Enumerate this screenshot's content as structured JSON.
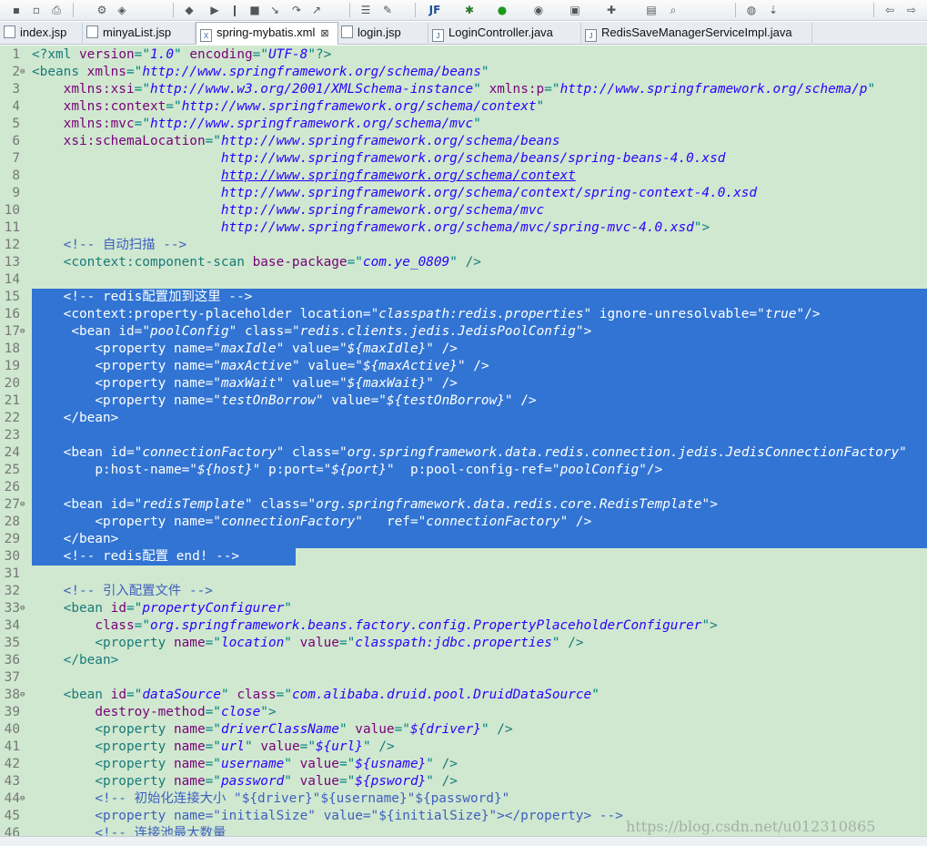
{
  "toolbar": {
    "icons": [
      "save-icon",
      "save-all-icon",
      "print-icon",
      "open-type-icon",
      "open-resource-icon",
      "toggle-breakpoint-icon",
      "resume-icon",
      "suspend-icon",
      "terminate-icon",
      "step-into-icon",
      "step-over-icon",
      "step-return-icon",
      "outline-icon",
      "toggle-comment-icon",
      "jf-icon",
      "debug-icon",
      "run-icon",
      "external-tools-icon",
      "new-server-icon",
      "new-wizard-icon",
      "open-folder-icon",
      "search-icon",
      "globe-icon",
      "next-annotation-icon",
      "back-icon",
      "forward-icon"
    ],
    "jf_label": "JF"
  },
  "tabs": [
    {
      "label": "index.jsp",
      "icon": "jsp-file-icon",
      "active": false
    },
    {
      "label": "minyaList.jsp",
      "icon": "jsp-file-icon",
      "active": false
    },
    {
      "label": "spring-mybatis.xml",
      "icon": "xml-file-icon",
      "active": true,
      "close": "⊠"
    },
    {
      "label": "login.jsp",
      "icon": "jsp-file-icon",
      "active": false
    },
    {
      "label": "LoginController.java",
      "icon": "java-file-icon",
      "active": false
    },
    {
      "label": "RedisSaveManagerServiceImpl.java",
      "icon": "java-file-icon",
      "active": false
    }
  ],
  "editor": {
    "background": "#cfe8cf",
    "selection_color": "#3174d3",
    "selected_lines": [
      15,
      30
    ],
    "lines": [
      {
        "n": "1",
        "m": "",
        "code": "<?xml version=\"1.0\" encoding=\"UTF-8\"?>"
      },
      {
        "n": "2",
        "m": "⊖",
        "code": "<beans xmlns=\"http://www.springframework.org/schema/beans\""
      },
      {
        "n": "3",
        "m": "",
        "code": "    xmlns:xsi=\"http://www.w3.org/2001/XMLSchema-instance\" xmlns:p=\"http://www.springframework.org/schema/p\""
      },
      {
        "n": "4",
        "m": "",
        "code": "    xmlns:context=\"http://www.springframework.org/schema/context\""
      },
      {
        "n": "5",
        "m": "",
        "code": "    xmlns:mvc=\"http://www.springframework.org/schema/mvc\""
      },
      {
        "n": "6",
        "m": "",
        "code": "    xsi:schemaLocation=\"http://www.springframework.org/schema/beans"
      },
      {
        "n": "7",
        "m": "",
        "code": "                        http://www.springframework.org/schema/beans/spring-beans-4.0.xsd"
      },
      {
        "n": "8",
        "m": "",
        "code": "                        http://www.springframework.org/schema/context"
      },
      {
        "n": "9",
        "m": "",
        "code": "                        http://www.springframework.org/schema/context/spring-context-4.0.xsd"
      },
      {
        "n": "10",
        "m": "",
        "code": "                        http://www.springframework.org/schema/mvc"
      },
      {
        "n": "11",
        "m": "",
        "code": "                        http://www.springframework.org/schema/mvc/spring-mvc-4.0.xsd\">"
      },
      {
        "n": "12",
        "m": "",
        "code": "    <!-- 自动扫描 -->"
      },
      {
        "n": "13",
        "m": "",
        "code": "    <context:component-scan base-package=\"com.ye_0809\" />"
      },
      {
        "n": "14",
        "m": "",
        "code": ""
      },
      {
        "n": "15",
        "m": "",
        "code": "    <!-- redis配置加到这里 -->"
      },
      {
        "n": "16",
        "m": "",
        "code": "    <context:property-placeholder location=\"classpath:redis.properties\" ignore-unresolvable=\"true\"/>"
      },
      {
        "n": "17",
        "m": "⊖",
        "code": "     <bean id=\"poolConfig\" class=\"redis.clients.jedis.JedisPoolConfig\">"
      },
      {
        "n": "18",
        "m": "",
        "code": "        <property name=\"maxIdle\" value=\"${maxIdle}\" />"
      },
      {
        "n": "19",
        "m": "",
        "code": "        <property name=\"maxActive\" value=\"${maxActive}\" />"
      },
      {
        "n": "20",
        "m": "",
        "code": "        <property name=\"maxWait\" value=\"${maxWait}\" />"
      },
      {
        "n": "21",
        "m": "",
        "code": "        <property name=\"testOnBorrow\" value=\"${testOnBorrow}\" />"
      },
      {
        "n": "22",
        "m": "",
        "code": "    </bean>"
      },
      {
        "n": "23",
        "m": "",
        "code": ""
      },
      {
        "n": "24",
        "m": "",
        "code": "    <bean id=\"connectionFactory\" class=\"org.springframework.data.redis.connection.jedis.JedisConnectionFactory\""
      },
      {
        "n": "25",
        "m": "",
        "code": "        p:host-name=\"${host}\" p:port=\"${port}\"  p:pool-config-ref=\"poolConfig\"/>"
      },
      {
        "n": "26",
        "m": "",
        "code": ""
      },
      {
        "n": "27",
        "m": "⊖",
        "code": "    <bean id=\"redisTemplate\" class=\"org.springframework.data.redis.core.RedisTemplate\">"
      },
      {
        "n": "28",
        "m": "",
        "code": "        <property name=\"connectionFactory\"   ref=\"connectionFactory\" />"
      },
      {
        "n": "29",
        "m": "",
        "code": "    </bean>"
      },
      {
        "n": "30",
        "m": "",
        "code": "    <!-- redis配置 end! -->"
      },
      {
        "n": "31",
        "m": "",
        "code": ""
      },
      {
        "n": "32",
        "m": "",
        "code": "    <!-- 引入配置文件 -->"
      },
      {
        "n": "33",
        "m": "⊖",
        "code": "    <bean id=\"propertyConfigurer\""
      },
      {
        "n": "34",
        "m": "",
        "code": "        class=\"org.springframework.beans.factory.config.PropertyPlaceholderConfigurer\">"
      },
      {
        "n": "35",
        "m": "",
        "code": "        <property name=\"location\" value=\"classpath:jdbc.properties\" />"
      },
      {
        "n": "36",
        "m": "",
        "code": "    </bean>"
      },
      {
        "n": "37",
        "m": "",
        "code": ""
      },
      {
        "n": "38",
        "m": "⊖",
        "code": "    <bean id=\"dataSource\" class=\"com.alibaba.druid.pool.DruidDataSource\""
      },
      {
        "n": "39",
        "m": "",
        "code": "        destroy-method=\"close\">"
      },
      {
        "n": "40",
        "m": "",
        "code": "        <property name=\"driverClassName\" value=\"${driver}\" />"
      },
      {
        "n": "41",
        "m": "",
        "code": "        <property name=\"url\" value=\"${url}\" />"
      },
      {
        "n": "42",
        "m": "",
        "code": "        <property name=\"username\" value=\"${usname}\" />"
      },
      {
        "n": "43",
        "m": "",
        "code": "        <property name=\"password\" value=\"${psword}\" />"
      },
      {
        "n": "44",
        "m": "⊖",
        "code": "        <!-- 初始化连接大小 \"${driver}\"${username}\"${password}\""
      },
      {
        "n": "45",
        "m": "",
        "code": "        <property name=\"initialSize\" value=\"${initialSize}\"></property> -->"
      },
      {
        "n": "46",
        "m": "",
        "code": "        <!-- 连接池最大数量"
      }
    ]
  },
  "watermark": "https://blog.csdn.net/u012310865"
}
